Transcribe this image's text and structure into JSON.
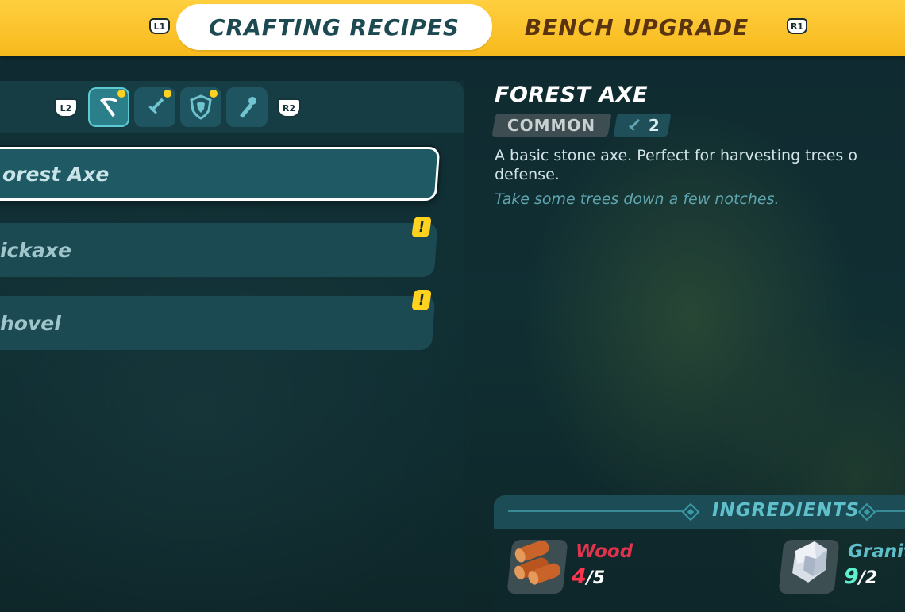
{
  "tabs": {
    "left_shoulder": "L1",
    "right_shoulder": "R1",
    "active": "CRAFTING RECIPES",
    "inactive": "BENCH UPGRADE"
  },
  "filters": {
    "left_trigger": "L2",
    "right_trigger": "R2",
    "categories": [
      {
        "icon": "pickaxe-icon",
        "selected": true,
        "new": true
      },
      {
        "icon": "sword-icon",
        "selected": false,
        "new": true
      },
      {
        "icon": "shield-icon",
        "selected": false,
        "new": true
      },
      {
        "icon": "torch-icon",
        "selected": false,
        "new": false
      }
    ]
  },
  "recipes": [
    {
      "label": "orest Axe",
      "selected": true,
      "new": false
    },
    {
      "label": "ickaxe",
      "selected": false,
      "new": true
    },
    {
      "label": "hovel",
      "selected": false,
      "new": true
    }
  ],
  "alert_symbol": "!",
  "detail": {
    "title": "FOREST AXE",
    "rarity": "COMMON",
    "tier": "2",
    "tier_icon": "sword-icon",
    "description_line1": "A basic stone axe. Perfect for harvesting trees o",
    "description_line2": "defense.",
    "flavor": "Take some trees down a few notches."
  },
  "ingredients": {
    "title": "INGREDIENTS",
    "items": [
      {
        "name": "Wood",
        "have": "4",
        "need": "/5",
        "name_color": "#e0334d",
        "have_color": "#ff3550",
        "icon": "wood-logs-icon"
      },
      {
        "name": "Granit",
        "have": "9",
        "need": "/2",
        "name_color": "#5fc0cb",
        "have_color": "#5ff0d0",
        "icon": "granite-icon"
      }
    ]
  },
  "colors": {
    "accent_yellow": "#ffcf3f",
    "teal": "#2a7f8a",
    "bg": "#0f2a30"
  }
}
